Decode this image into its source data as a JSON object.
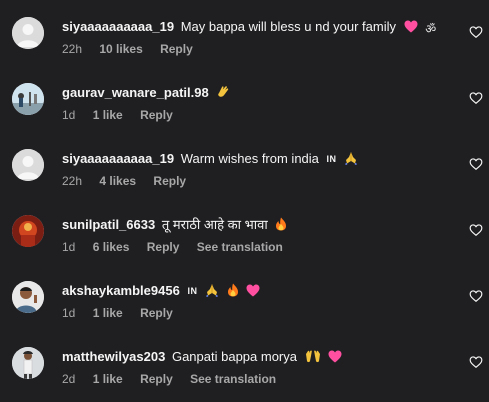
{
  "comments": [
    {
      "username": "siyaaaaaaaaaa_19",
      "text": "May bappa will bless u nd your family",
      "emojis": [
        "pink-heart",
        "om"
      ],
      "time": "22h",
      "likes": "10 likes",
      "reply": "Reply",
      "translation": ""
    },
    {
      "username": "gaurav_wanare_patil.98",
      "text": "",
      "emojis": [
        "clapping-hands"
      ],
      "time": "1d",
      "likes": "1 like",
      "reply": "Reply",
      "translation": ""
    },
    {
      "username": "siyaaaaaaaaaa_19",
      "text": "Warm wishes from india",
      "flag": "IN",
      "emojis": [
        "folded-hands"
      ],
      "time": "22h",
      "likes": "4 likes",
      "reply": "Reply",
      "translation": ""
    },
    {
      "username": "sunilpatil_6633",
      "text": "तू मराठी आहे का भावा",
      "emojis": [
        "fire"
      ],
      "time": "1d",
      "likes": "6 likes",
      "reply": "Reply",
      "translation": "See translation"
    },
    {
      "username": "akshaykamble9456",
      "text": "",
      "flag": "IN",
      "emojis": [
        "folded-hands",
        "fire",
        "pink-heart"
      ],
      "time": "1d",
      "likes": "1 like",
      "reply": "Reply",
      "translation": ""
    },
    {
      "username": "matthewilyas203",
      "text": "Ganpati bappa morya",
      "emojis": [
        "raised-hands",
        "pink-heart"
      ],
      "time": "2d",
      "likes": "1 like",
      "reply": "Reply",
      "translation": "See translation"
    }
  ],
  "colors": {
    "background": "#1f1f22",
    "primary_text": "#f5f5f5",
    "secondary_text": "#a8a8a8",
    "pink_heart": "#ff4fa0",
    "fire": "#ff7a1a"
  }
}
